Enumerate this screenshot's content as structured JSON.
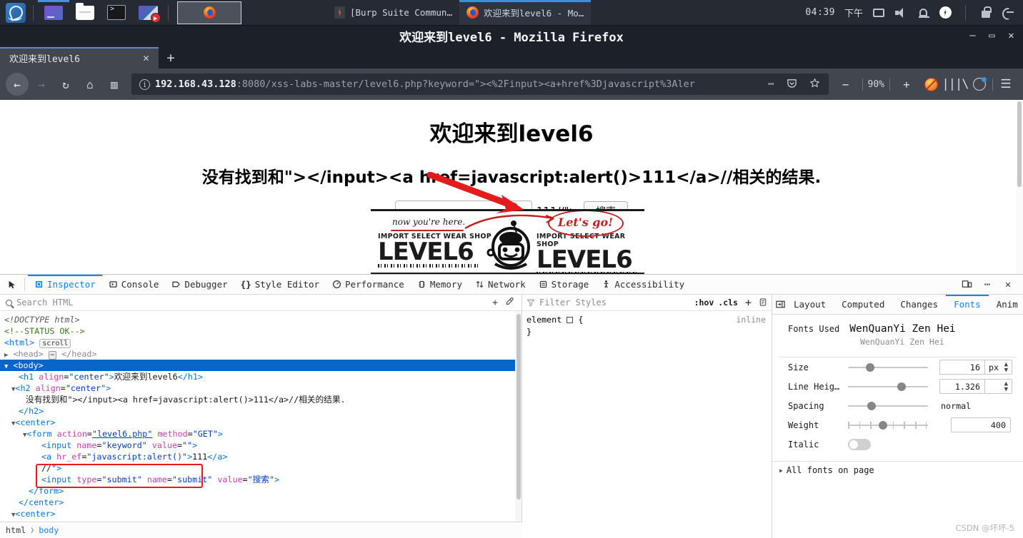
{
  "taskbar": {
    "launchers": [
      {
        "name": "kali-menu",
        "icon": "kali-dragon-icon"
      },
      {
        "name": "file-manager",
        "icon": "files-icon"
      },
      {
        "name": "terminal",
        "icon": "terminal-icon"
      },
      {
        "name": "screen-recorder",
        "icon": "screen-record-icon"
      }
    ],
    "windows": [
      {
        "label": "[Burp Suite Commun…",
        "icon": "burp-suite-icon",
        "active": false
      },
      {
        "label": "欢迎来到level6 - Mo…",
        "icon": "firefox-icon",
        "active": true
      }
    ],
    "clock": "04:39",
    "ampm": "下午",
    "tray": [
      "display-icon",
      "volume-icon",
      "bell-icon",
      "power-icon",
      "lock-icon",
      "logout-icon"
    ]
  },
  "browser": {
    "window_title": "欢迎来到level6 - Mozilla Firefox",
    "window_controls": {
      "minimize": "—",
      "maximize": "▭",
      "close": "✕"
    },
    "tab": {
      "title": "欢迎来到level6",
      "close": "✕"
    },
    "new_tab": "+",
    "nav": {
      "back": "←",
      "forward": "→",
      "reload": "↻",
      "home": "⌂",
      "sidebar": "▥"
    },
    "url": {
      "host": "192.168.43.128",
      "rest": ":8080/xss-labs-master/level6.php?keyword=\"><%2Finput><a+href%3Djavascript%3Aler",
      "full": "192.168.43.128:8080/xss-labs-master/level6.php?keyword=\"><%2Finput><a+href%3Djavascript%3Aler"
    },
    "url_actions": {
      "more": "⋯",
      "pocket": "pocket-icon",
      "bookmark": "star-icon"
    },
    "zoom": {
      "minus": "−",
      "level": "90%",
      "plus": "+"
    },
    "toolbar_icons": [
      "noscript-icon",
      "library-icon",
      "account-icon",
      "hamburger-menu-icon"
    ]
  },
  "page": {
    "h1": "欢迎来到level6",
    "h2": "没有找到和\"></input><a href=javascript:alert()>111</a>//相关的结果.",
    "input_value": "",
    "leaked_text": "111//\">",
    "submit_label": "搜索",
    "banner": {
      "left_sub": "IMPORT SELECT WEAR SHOP",
      "left_main": "LEVEL6",
      "right_sub": "IMPORT SELECT WEAR SHOP",
      "right_main": "LEVEL6",
      "scribble_left": "now you're here.",
      "scribble_right": "Let's go!"
    }
  },
  "devtools": {
    "picker_icon": "element-picker-icon",
    "tabs": [
      {
        "label": "Inspector",
        "icon": "inspector-icon",
        "active": true
      },
      {
        "label": "Console",
        "icon": "console-icon",
        "active": false
      },
      {
        "label": "Debugger",
        "icon": "debugger-icon",
        "active": false
      },
      {
        "label": "Style Editor",
        "icon": "style-editor-icon",
        "active": false
      },
      {
        "label": "Performance",
        "icon": "performance-icon",
        "active": false
      },
      {
        "label": "Memory",
        "icon": "memory-icon",
        "active": false
      },
      {
        "label": "Network",
        "icon": "network-icon",
        "active": false
      },
      {
        "label": "Storage",
        "icon": "storage-icon",
        "active": false
      },
      {
        "label": "Accessibility",
        "icon": "accessibility-icon",
        "active": false
      }
    ],
    "toolbar_right": [
      "responsive-design-icon",
      "devtools-options-icon",
      "close-devtools-icon"
    ],
    "search": {
      "placeholder": "Search HTML",
      "add_node": "+",
      "eyedropper": "eyedropper-icon"
    },
    "markup": {
      "doctype": "<!DOCTYPE html>",
      "comment": "<!--STATUS OK-->",
      "html_tag": "<html>",
      "html_badge": "scroll",
      "head_line": "<head> … </head>",
      "body_tag": "<body>",
      "h1_line": "<h1 align=\"center\">欢迎来到level6</h1>",
      "h2_open": "<h2 align=\"center\">",
      "h2_text": "没有找到和\"></input><a href=javascript:alert()>111</a>//相关的结果.",
      "h2_close": "</h2>",
      "center_open": "<center>",
      "form_open": "<form action=\"level6.php\" method=\"GET\">",
      "input_keyword": "<input name=\"keyword\" value=\"\">",
      "a_tag": "<a hr_ef=\"javascript:alert()\">111</a>",
      "a_tail": "//\">",
      "input_submit": "<input type=\"submit\" name=\"submit\" value=\"搜索\">",
      "form_close": "</form>",
      "center_close": "</center>",
      "center_open2": "<center>"
    },
    "breadcrumb": [
      "html",
      "body"
    ],
    "rules": {
      "filter_placeholder": "Filter Styles",
      "hov": ":hov",
      "cls": ".cls",
      "add": "+",
      "doc_icon": "stylesheet-icon",
      "selector": "element",
      "open_brace": "{",
      "close_brace": "}",
      "source": "inline"
    },
    "right_tabs": [
      {
        "label": "Layout",
        "active": false
      },
      {
        "label": "Computed",
        "active": false
      },
      {
        "label": "Changes",
        "active": false
      },
      {
        "label": "Fonts",
        "active": true
      },
      {
        "label": "Anim",
        "active": false
      }
    ],
    "fonts": {
      "used_label": "Fonts Used",
      "used_name": "WenQuanYi Zen Hei",
      "used_sub": "WenQuanYi Zen Hei",
      "rows": [
        {
          "label": "Size",
          "value": "16",
          "unit": "px",
          "knob_pct": 22
        },
        {
          "label": "Line Heig…",
          "value": "1.326",
          "unit": "",
          "knob_pct": 62
        },
        {
          "label": "Spacing",
          "value": "normal",
          "unit": null,
          "knob_pct": 24
        },
        {
          "label": "Weight",
          "value": "400",
          "unit": null,
          "knob_pct": 38
        }
      ],
      "italic_label": "Italic",
      "italic_on": false,
      "all_fonts": "All fonts on page"
    }
  },
  "watermark": "CSDN @坏坏-5"
}
